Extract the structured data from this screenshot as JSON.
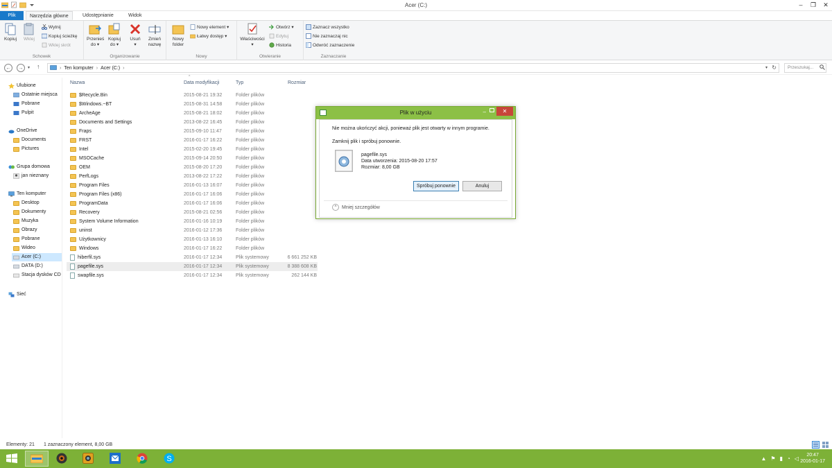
{
  "window": {
    "title": "Acer (C:)",
    "minimize": "–",
    "maximize": "❐",
    "close": "✕"
  },
  "tabs": [
    {
      "label": "Plik"
    },
    {
      "label": "Narzędzia główne"
    },
    {
      "label": "Udostępnianie"
    },
    {
      "label": "Widok"
    }
  ],
  "ribbon": {
    "groups": [
      {
        "label": "Schowek"
      },
      {
        "label": "Organizowanie"
      },
      {
        "label": "Nowy"
      },
      {
        "label": "Otwieranie"
      },
      {
        "label": "Zaznaczanie"
      }
    ],
    "kopiuj": "Kopiuj",
    "wklej": "Wklej",
    "wytnij": "Wytnij",
    "kopiuj_sciezke": "Kopiuj ścieżkę",
    "wklej_skrot": "Wklej skrót",
    "przenies_do_1": "Przenieś",
    "przenies_do_2": "do ▾",
    "kopiuj_do_1": "Kopiuj",
    "kopiuj_do_2": "do ▾",
    "usun_1": "Usuń",
    "usun_2": "▾",
    "zmien_1": "Zmień",
    "zmien_2": "nazwę",
    "nowy_folder_1": "Nowy",
    "nowy_folder_2": "folder",
    "nowy_element": "Nowy element ▾",
    "latwy_dostep": "Łatwy dostęp ▾",
    "wlasciwosci_1": "Właściwości",
    "wlasciwosci_2": "▾",
    "otworz": "Otwórz ▾",
    "edytuj": "Edytuj",
    "historia": "Historia",
    "zaznacz_wszystko": "Zaznacz wszystko",
    "nie_zaznaczaj": "Nie zaznaczaj nic",
    "odwroc": "Odwróć zaznaczenie"
  },
  "address": {
    "back": "←",
    "forward": "→",
    "up": "↑",
    "crumb1": "Ten komputer",
    "crumb2": "Acer (C:)",
    "refresh": "↻",
    "search_placeholder": "Przeszukaj..."
  },
  "nav": {
    "items": [
      {
        "label": "Ulubione"
      },
      {
        "label": "Ostatnie miejsca"
      },
      {
        "label": "Pobrane"
      },
      {
        "label": "Pulpit"
      },
      {
        "label": "OneDrive"
      },
      {
        "label": "Documents"
      },
      {
        "label": "Pictures"
      },
      {
        "label": "Grupa domowa"
      },
      {
        "label": "jan nieznany"
      },
      {
        "label": "Ten komputer"
      },
      {
        "label": "Desktop"
      },
      {
        "label": "Dokumenty"
      },
      {
        "label": "Muzyka"
      },
      {
        "label": "Obrazy"
      },
      {
        "label": "Pobrane"
      },
      {
        "label": "Wideo"
      },
      {
        "label": "Acer (C:)"
      },
      {
        "label": "DATA (D:)"
      },
      {
        "label": "Stacja dysków CD"
      },
      {
        "label": "Sieć"
      }
    ]
  },
  "columns": {
    "name": "Nazwa",
    "date": "Data modyfikacji",
    "type": "Typ",
    "size": "Rozmiar",
    "sort_indicator": "^"
  },
  "files": [
    {
      "name": "$Recycle.Bin",
      "date": "2015-08-21 19:32",
      "type": "Folder plików",
      "size": ""
    },
    {
      "name": "$Windows.~BT",
      "date": "2015-08-31 14:58",
      "type": "Folder plików",
      "size": ""
    },
    {
      "name": "ArcheAge",
      "date": "2015-08-21 18:02",
      "type": "Folder plików",
      "size": ""
    },
    {
      "name": "Documents and Settings",
      "date": "2013-08-22 16:45",
      "type": "Folder plików",
      "size": ""
    },
    {
      "name": "Fraps",
      "date": "2015-09-10 11:47",
      "type": "Folder plików",
      "size": ""
    },
    {
      "name": "FRST",
      "date": "2016-01-17 16:22",
      "type": "Folder plików",
      "size": ""
    },
    {
      "name": "Intel",
      "date": "2015-02-20 19:45",
      "type": "Folder plików",
      "size": ""
    },
    {
      "name": "MSOCache",
      "date": "2015-09-14 20:50",
      "type": "Folder plików",
      "size": ""
    },
    {
      "name": "OEM",
      "date": "2015-08-20 17:20",
      "type": "Folder plików",
      "size": ""
    },
    {
      "name": "PerfLogs",
      "date": "2013-08-22 17:22",
      "type": "Folder plików",
      "size": ""
    },
    {
      "name": "Program Files",
      "date": "2016-01-13 16:07",
      "type": "Folder plików",
      "size": ""
    },
    {
      "name": "Program Files (x86)",
      "date": "2016-01-17 16:06",
      "type": "Folder plików",
      "size": ""
    },
    {
      "name": "ProgramData",
      "date": "2016-01-17 16:06",
      "type": "Folder plików",
      "size": ""
    },
    {
      "name": "Recovery",
      "date": "2015-08-21 02:56",
      "type": "Folder plików",
      "size": ""
    },
    {
      "name": "System Volume Information",
      "date": "2016-01-16 10:19",
      "type": "Folder plików",
      "size": ""
    },
    {
      "name": "uninst",
      "date": "2016-01-12 17:36",
      "type": "Folder plików",
      "size": ""
    },
    {
      "name": "Użytkownicy",
      "date": "2016-01-13 16:10",
      "type": "Folder plików",
      "size": ""
    },
    {
      "name": "Windows",
      "date": "2016-01-17 16:22",
      "type": "Folder plików",
      "size": ""
    },
    {
      "name": "hiberfil.sys",
      "date": "2016-01-17 12:34",
      "type": "Plik systemowy",
      "size": "6 661 252 KB"
    },
    {
      "name": "pagefile.sys",
      "date": "2016-01-17 12:34",
      "type": "Plik systemowy",
      "size": "8 388 608 KB"
    },
    {
      "name": "swapfile.sys",
      "date": "2016-01-17 12:34",
      "type": "Plik systemowy",
      "size": "262 144 KB"
    }
  ],
  "status": {
    "count": "Elementy: 21",
    "selected": "1 zaznaczony element, 8,00 GB"
  },
  "dialog": {
    "title": "Plik w użyciu",
    "message": "Nie można ukończyć akcji, ponieważ plik jest otwarty w innym programie.",
    "instruction": "Zamknij plik i spróbuj ponownie.",
    "file_name": "pagefile.sys",
    "file_created": "Data utworzenia: 2015-08-20 17:57",
    "file_size": "Rozmiar: 8,00 GB",
    "retry": "Spróbuj ponownie",
    "cancel": "Anuluj",
    "less_details": "Mniej szczegółów",
    "minimize": "–",
    "close": "✕"
  },
  "taskbar": {
    "time": "20:47",
    "date": "2016-01-17",
    "accent": "#7db137"
  },
  "colors": {
    "file_tab": "#1979ca",
    "dialog_title": "#8cc046",
    "close_red": "#c7463a"
  }
}
